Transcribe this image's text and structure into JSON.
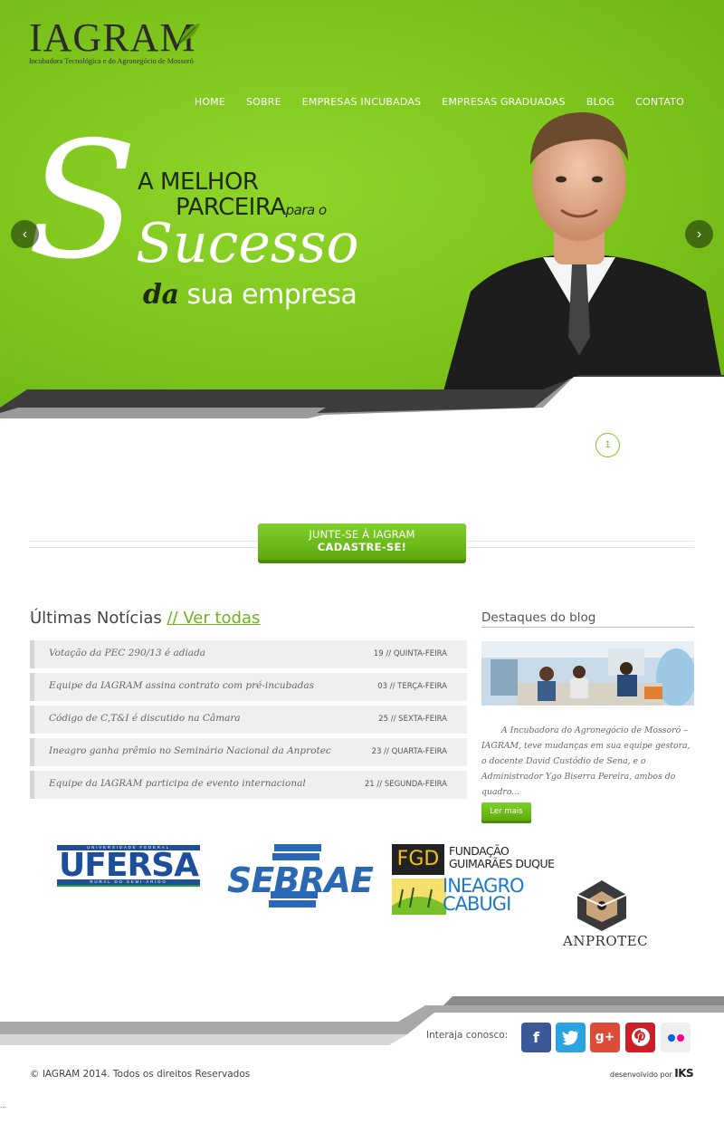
{
  "brand": {
    "name": "IAGRAM",
    "tagline": "Incubadora Tecnológica e do Agronegócio de Mossoró"
  },
  "nav": {
    "items": [
      "HOME",
      "SOBRE",
      "EMPRESAS INCUBADAS",
      "EMPRESAS GRADUADAS",
      "BLOG",
      "CONTATO"
    ]
  },
  "hero": {
    "line1": "A MELHOR",
    "line2": "PARCEIRA",
    "line2_small": "para o",
    "word": "Sucesso",
    "line3_dark": "da",
    "line3": "sua empresa",
    "prev_icon": "chevron-left-icon",
    "next_icon": "chevron-right-icon",
    "pager": "1"
  },
  "cta": {
    "top": "JUNTE-SE À IAGRAM",
    "bottom": "CADASTRE-SE!"
  },
  "news": {
    "title": "Últimas Notícias",
    "link": "// Ver todas",
    "items": [
      {
        "title": "Votação da PEC 290/13 é adiada",
        "date": "19 // QUINTA-FEIRA"
      },
      {
        "title": "Equipe da IAGRAM assina contrato com pré-incubadas",
        "date": "03 // TERÇA-FEIRA"
      },
      {
        "title": "Código de C,T&I é discutido na Câmara",
        "date": "25 // SEXTA-FEIRA"
      },
      {
        "title": "Ineagro ganha prêmio no Seminário Nacional da Anprotec",
        "date": "23 // QUARTA-FEIRA"
      },
      {
        "title": "Equipe da IAGRAM participa de evento internacional",
        "date": "21 // SEGUNDA-FEIRA"
      }
    ]
  },
  "blog": {
    "title": "Destaques do blog",
    "excerpt": "A Incubadora do Agronegócio de Mossoró – IAGRAM, teve mudanças em sua equipe gestora, o docente David Custódio de Sena, e o Administrador Ygo Biserra Pereira, ambos do quadro...",
    "button": "Ler mais"
  },
  "partners": {
    "ufersa": {
      "name": "UFERSA",
      "top": "UNIVERSIDADE FEDERAL",
      "bottom": "RURAL DO SEMI-ÁRIDO"
    },
    "sebrae": {
      "name": "SEBRAE"
    },
    "fgd": {
      "abbr": "FGD",
      "name_line1": "FUNDAÇÃO",
      "name_line2": "GUIMARÃES DUQUE",
      "sub_line1": "INEAGRO",
      "sub_line2": "CABUGI"
    },
    "anprotec": {
      "name": "ANPROTEC"
    }
  },
  "footer": {
    "interact": "Interaja conosco:",
    "social": [
      {
        "name": "facebook",
        "glyph": "f"
      },
      {
        "name": "twitter",
        "glyph": "t"
      },
      {
        "name": "google-plus",
        "glyph": "g+"
      },
      {
        "name": "pinterest",
        "glyph": "P"
      },
      {
        "name": "flickr",
        "glyph": ""
      }
    ],
    "copyright": "© IAGRAM 2014. Todos os direitos Reservados",
    "developed_by": "desenvolvido por",
    "developer": "IKS",
    "corner_mark": "..."
  },
  "colors": {
    "brand_green": "#7dc61c",
    "accent_green": "#6db31a",
    "dark": "#2b2b2b"
  }
}
